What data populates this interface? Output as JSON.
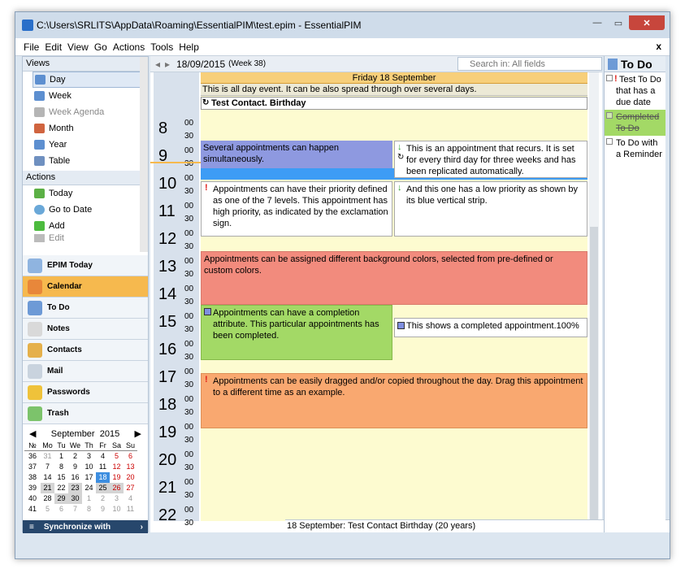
{
  "window": {
    "title": "C:\\Users\\SRLITS\\AppData\\Roaming\\EssentialPIM\\test.epim - EssentialPIM",
    "min_label": "—",
    "max_label": "▭",
    "close_label": "✕"
  },
  "menu": {
    "items": [
      "File",
      "Edit",
      "View",
      "Go",
      "Actions",
      "Tools",
      "Help"
    ],
    "close_label": "x"
  },
  "views": {
    "header": "Views",
    "items": [
      {
        "label": "Day",
        "icon": "day-view-icon"
      },
      {
        "label": "Week",
        "icon": "week-view-icon"
      },
      {
        "label": "Week Agenda",
        "icon": "week-agenda-icon"
      },
      {
        "label": "Month",
        "icon": "month-view-icon"
      },
      {
        "label": "Year",
        "icon": "year-view-icon"
      },
      {
        "label": "Table",
        "icon": "table-view-icon"
      }
    ]
  },
  "actions": {
    "header": "Actions",
    "items": [
      {
        "label": "Today",
        "icon": "checkmark-calendar-icon"
      },
      {
        "label": "Go to Date",
        "icon": "go-to-date-icon"
      },
      {
        "label": "Add",
        "icon": "add-plus-icon"
      },
      {
        "label": "Edit",
        "icon": "edit-pencil-icon"
      }
    ]
  },
  "modules": [
    {
      "label": "EPIM Today",
      "icon": "epim-today-icon",
      "active": false
    },
    {
      "label": "Calendar",
      "icon": "calendar-icon",
      "active": true
    },
    {
      "label": "To Do",
      "icon": "todo-clipboard-icon",
      "active": false
    },
    {
      "label": "Notes",
      "icon": "notes-icon",
      "active": false
    },
    {
      "label": "Contacts",
      "icon": "contacts-icon",
      "active": false
    },
    {
      "label": "Mail",
      "icon": "mail-envelope-icon",
      "active": false
    },
    {
      "label": "Passwords",
      "icon": "padlock-icon",
      "active": false
    },
    {
      "label": "Trash",
      "icon": "trash-bin-icon",
      "active": false
    }
  ],
  "minical": {
    "prev_label": "◀",
    "next_label": "▶",
    "month": "September",
    "year": "2015",
    "headers": [
      "№",
      "Mo",
      "Tu",
      "We",
      "Th",
      "Fr",
      "Sa",
      "Su"
    ],
    "weeks": [
      [
        "36",
        "31",
        "1",
        "2",
        "3",
        "4",
        "5",
        "6"
      ],
      [
        "37",
        "7",
        "8",
        "9",
        "10",
        "11",
        "12",
        "13"
      ],
      [
        "38",
        "14",
        "15",
        "16",
        "17",
        "18",
        "19",
        "20"
      ],
      [
        "39",
        "21",
        "22",
        "23",
        "24",
        "25",
        "26",
        "27"
      ],
      [
        "40",
        "28",
        "29",
        "30",
        "1",
        "2",
        "3",
        "4"
      ],
      [
        "41",
        "5",
        "6",
        "7",
        "8",
        "9",
        "10",
        "11"
      ]
    ],
    "selected": "18"
  },
  "sync": {
    "label": "Synchronize with",
    "icon_label": "≡",
    "arrow": "›"
  },
  "calendar": {
    "prev_label": "◂",
    "next_label": "▸",
    "date": "18/09/2015",
    "week": "(Week 38)",
    "search_placeholder": "Search in: All fields",
    "day_header": "Friday 18 September",
    "allday_event": "This is all day event. It can be also spread through over several days.",
    "birthday_event": "Test Contact. Birthday",
    "hours": [
      "8",
      "9",
      "10",
      "11",
      "12",
      "13",
      "14",
      "15",
      "16",
      "17",
      "18",
      "19",
      "20",
      "21",
      "22"
    ],
    "min00": "00",
    "min30": "30",
    "appointments": [
      {
        "id": "simultaneous",
        "text": "Several appointments can happen simultaneously.",
        "color": "#8e99e0"
      },
      {
        "id": "recurs",
        "text": "This is an appointment that recurs. It is set for every third day for three weeks and has been replicated automatically.",
        "color": "#ffffff"
      },
      {
        "id": "priority",
        "text": "Appointments can have their priority defined as one of the 7 levels. This appointment has high priority, as indicated by the exclamation sign.",
        "color": "#ffffff"
      },
      {
        "id": "low-priority",
        "text": "And this one has a low priority as shown by its blue vertical strip.",
        "color": "#ffffff"
      },
      {
        "id": "colors",
        "text": "Appointments can be assigned different background colors, selected from pre-defined or custom colors.",
        "color": "#f28b7d"
      },
      {
        "id": "completion",
        "text": "Appointments can have a completion attribute. This particular appointments has been completed.",
        "color": "#a3d966"
      },
      {
        "id": "completed",
        "text": "This shows a completed appointment.100%",
        "color": "#ffffff"
      },
      {
        "id": "drag",
        "text": "Appointments can be easily dragged and/or copied throughout the day. Drag this appointment to a different time as an example.",
        "color": "#f9a870"
      }
    ],
    "status": "18 September:  Test Contact Birthday  (20 years)"
  },
  "todo": {
    "header": "To Do",
    "items": [
      {
        "text": "Test To Do that has a due date",
        "done": false
      },
      {
        "text": "Completed To Do",
        "done": true
      },
      {
        "text": "To Do with a Reminder",
        "done": false
      }
    ]
  },
  "colors": {
    "calendar_active": "#f6b94e",
    "day_bg": "#fdfbd0",
    "header_bg": "#f7cf7a",
    "current_time": "#3d9cf5"
  }
}
